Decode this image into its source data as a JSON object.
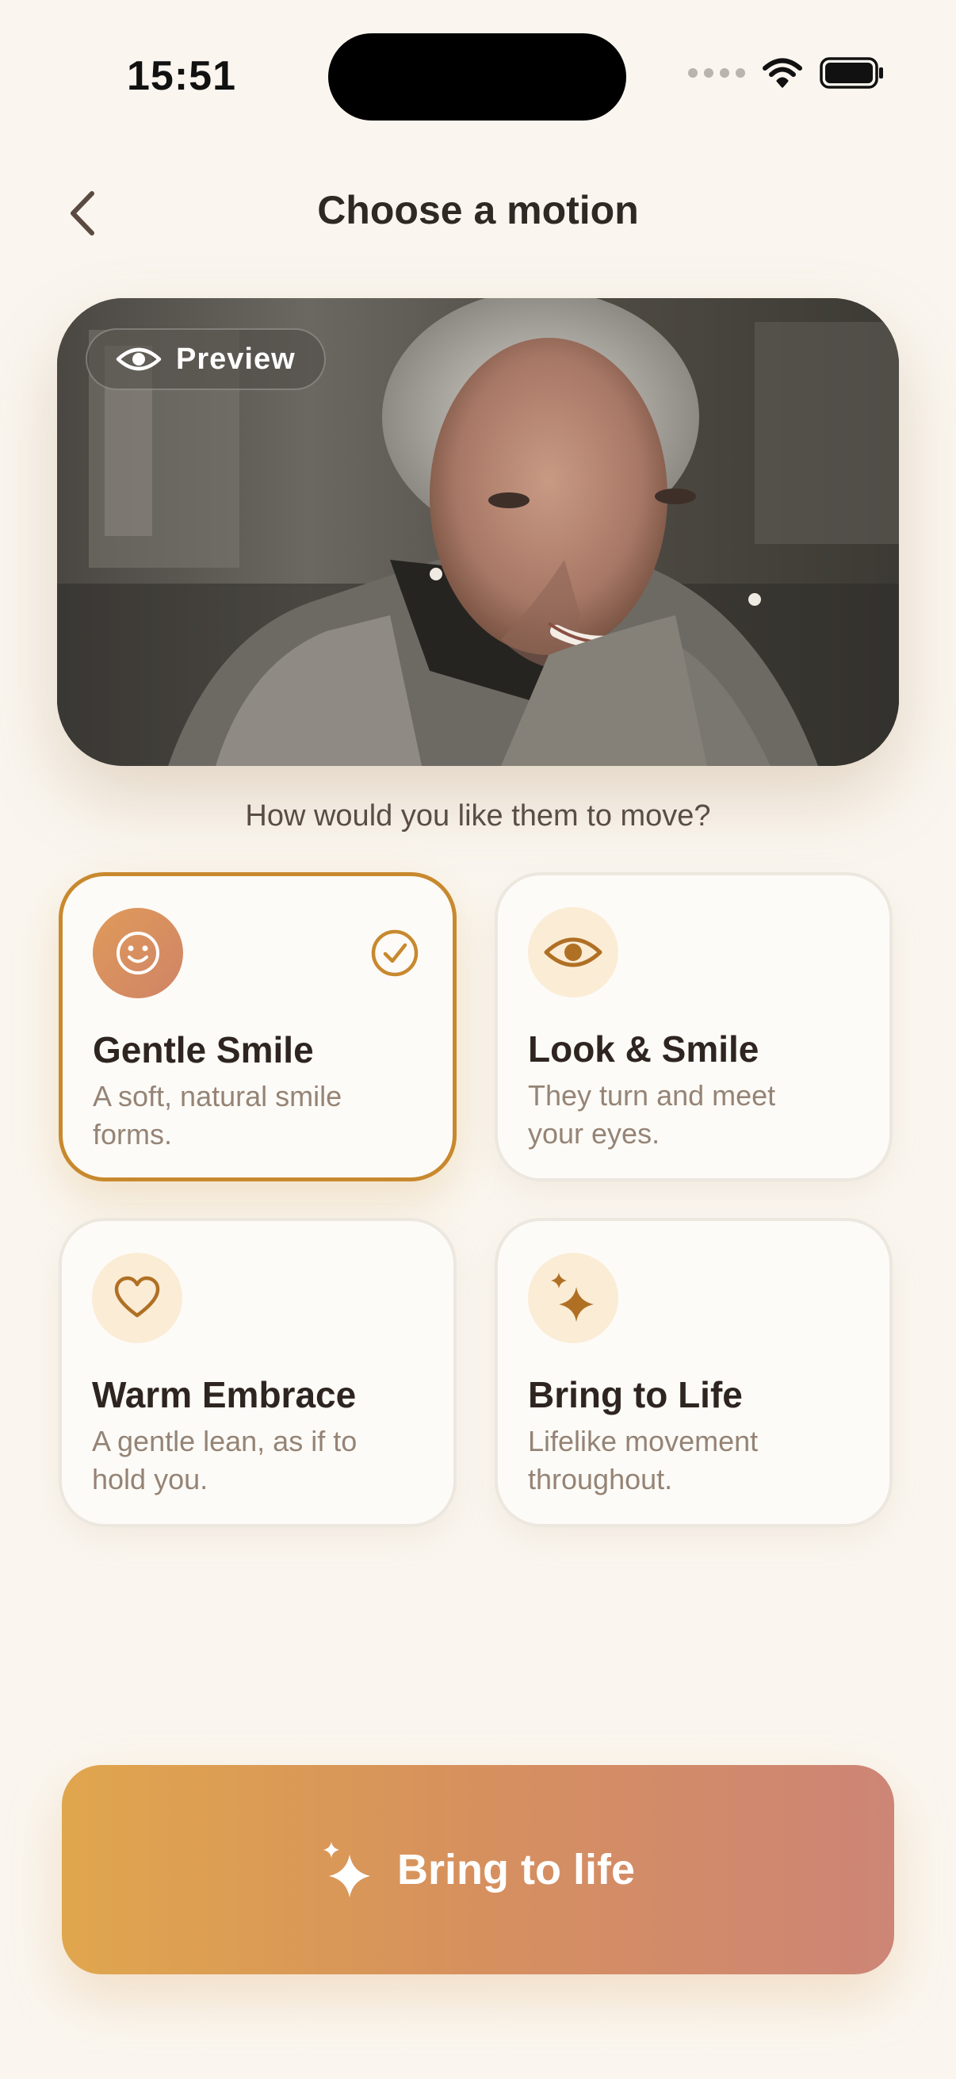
{
  "status_bar": {
    "time": "15:51"
  },
  "header": {
    "title": "Choose a motion"
  },
  "preview": {
    "badge_label": "Preview"
  },
  "question": "How would you like them to move?",
  "motions": [
    {
      "title": "Gentle Smile",
      "description": "A soft, natural smile forms.",
      "icon": "smile-icon",
      "selected": true
    },
    {
      "title": "Look & Smile",
      "description": "They turn and meet your eyes.",
      "icon": "eye-icon",
      "selected": false
    },
    {
      "title": "Warm Embrace",
      "description": "A gentle lean, as if to hold you.",
      "icon": "heart-icon",
      "selected": false
    },
    {
      "title": "Bring to Life",
      "description": "Lifelike movement throughout.",
      "icon": "sparkles-icon",
      "selected": false
    }
  ],
  "cta": {
    "label": "Bring to life",
    "icon": "sparkles-icon"
  },
  "colors": {
    "background": "#faf6ef",
    "accent": "#c8892e",
    "cta_start": "#e0a64d",
    "cta_end": "#cd8576"
  }
}
